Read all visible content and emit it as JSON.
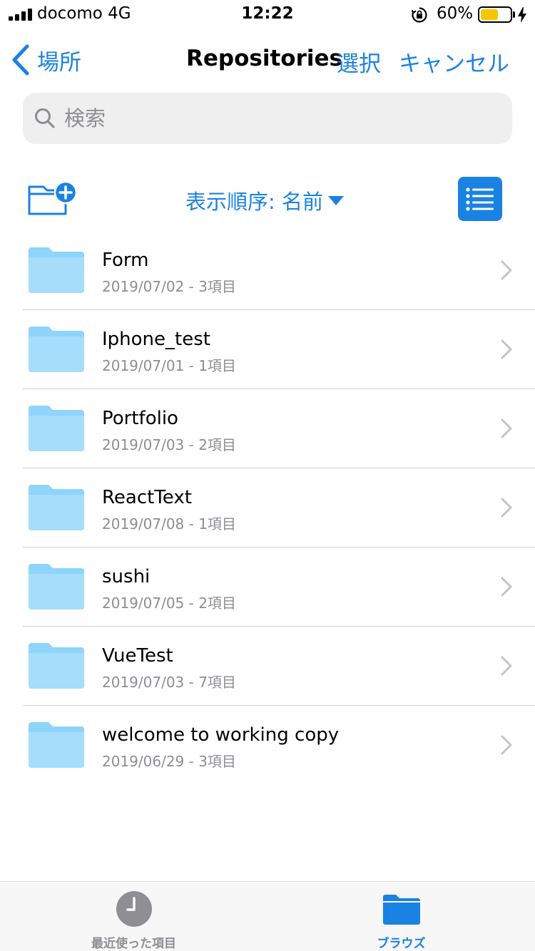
{
  "status_bar": {
    "carrier": "docomo   4G",
    "time": "12:22",
    "battery_percent": "60%",
    "battery_level": 0.6,
    "battery_color": "#f6c700"
  },
  "nav": {
    "back_label": "場所",
    "title": "Repositories",
    "select_label": "選択",
    "cancel_label": "キャンセル"
  },
  "search": {
    "placeholder": "検索"
  },
  "toolbar": {
    "sort_label": "表示順序: 名前",
    "new_folder_icon": "folder-plus-icon",
    "view_toggle_icon": "list-icon"
  },
  "files": [
    {
      "name": "Form",
      "meta": "2019/07/02 - 3項目"
    },
    {
      "name": "Iphone_test",
      "meta": "2019/07/01 - 1項目"
    },
    {
      "name": "Portfolio",
      "meta": "2019/07/03 - 2項目"
    },
    {
      "name": "ReactText",
      "meta": "2019/07/08 - 1項目"
    },
    {
      "name": "sushi",
      "meta": "2019/07/05 - 2項目"
    },
    {
      "name": "VueTest",
      "meta": "2019/07/03 - 7項目"
    },
    {
      "name": "welcome to working copy",
      "meta": "2019/06/29 - 3項目"
    }
  ],
  "tabs": {
    "recents_label": "最近使った項目",
    "browse_label": "ブラウズ"
  },
  "colors": {
    "accent": "#1a82e2",
    "folder": "#8ed4fb",
    "secondary_text": "#8e8e93"
  }
}
